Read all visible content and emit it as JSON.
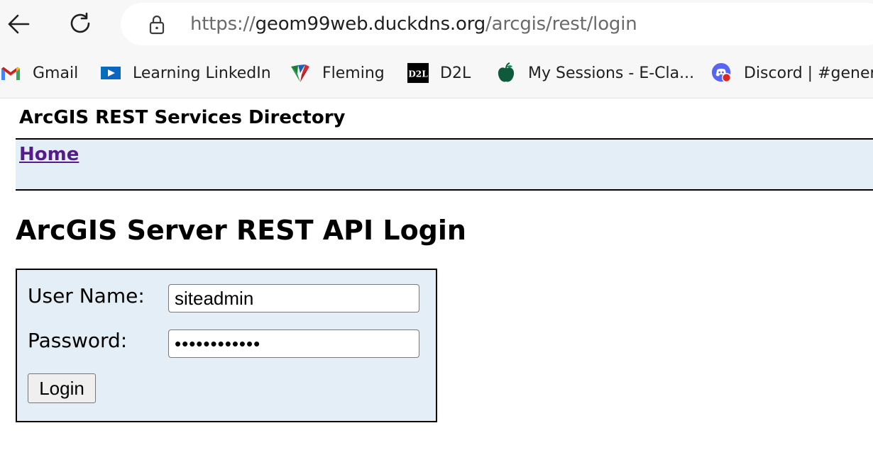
{
  "browser": {
    "url_prefix": "https://",
    "url_host": "geom99web.duckdns.org",
    "url_path": "/arcgis/rest/login",
    "bookmarks": [
      {
        "label": "Gmail",
        "icon": "gmail-icon"
      },
      {
        "label": "Learning LinkedIn",
        "icon": "linkedin-learning-icon"
      },
      {
        "label": "Fleming",
        "icon": "fleming-icon"
      },
      {
        "label": "D2L",
        "icon": "d2l-icon"
      },
      {
        "label": "My Sessions - E-Cla...",
        "icon": "apple-icon"
      },
      {
        "label": "Discord | #genera",
        "icon": "discord-icon"
      }
    ],
    "colors": {
      "toolbar_bg": "#f7f7f7",
      "gmail_red": "#ea4335",
      "linkedin_blue": "#0a66c2"
    }
  },
  "page": {
    "directory_title": "ArcGIS REST Services Directory",
    "nav_home": "Home",
    "heading": "ArcGIS Server REST API Login",
    "login": {
      "username_label": "User Name:",
      "username_value": "siteadmin",
      "password_label": "Password:",
      "password_value": "••••••••••••",
      "login_button": "Login"
    },
    "colors": {
      "panel_bg": "#e4eef7",
      "link_visited": "#551a8b"
    }
  }
}
